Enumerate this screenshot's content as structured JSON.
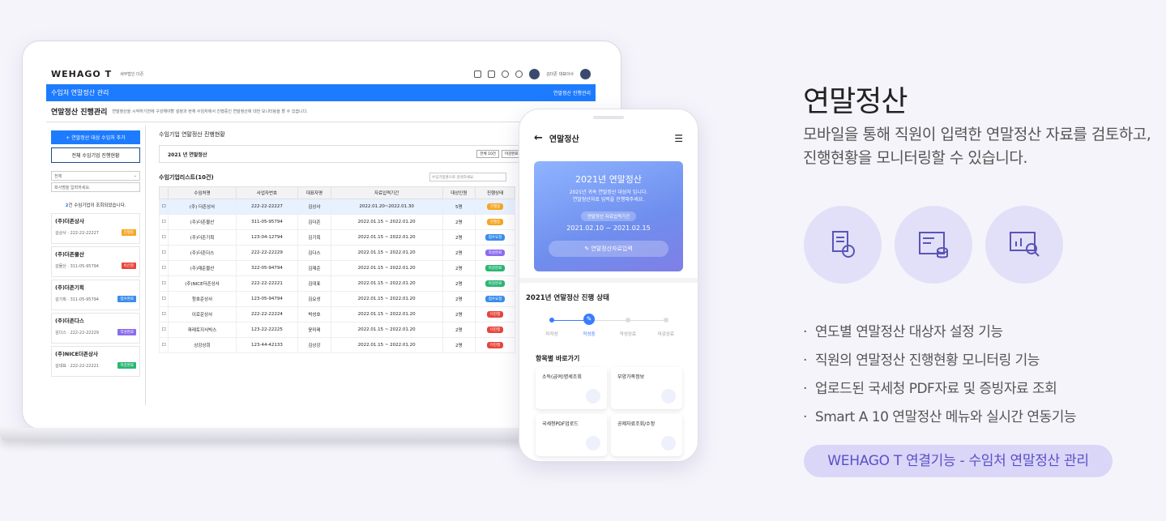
{
  "app": {
    "logo_prefix": "WEHAGO",
    "logo_suffix": "T",
    "company": "세무법인 더존"
  },
  "topbar": {
    "user": "김더존 대표이사"
  },
  "module": {
    "title": "수임처 연말정산 관리",
    "right": "연말정산 진행관리"
  },
  "page": {
    "title": "연말정산 진행관리",
    "desc": "연말정산을 시작하기전에 구성해야할 설정과 현재 수임처에서 진행중인 연말정산에 대한 모니터링을 할 수 있습니다."
  },
  "left": {
    "add_button": "연말정산 대상 수임처 추가",
    "status_button": "전체 수임기업 진행현황",
    "filter_value": "전체",
    "search_placeholder": "회사명을 입력하세요.",
    "count": "2",
    "count_text": "건 수임기업이 조회되었습니다.",
    "cards": [
      {
        "name": "(주)더존상사",
        "owner": "김상사 · 222-22-22227",
        "tag": "진행중",
        "color": "#f5a623"
      },
      {
        "name": "(주)더존물산",
        "owner": "김물산 · 311-05-95794",
        "tag": "비신청",
        "color": "#e8453c"
      },
      {
        "name": "(주)더존기획",
        "owner": "김기획 · 311-05-95794",
        "tag": "접수완료",
        "color": "#3b8dea"
      },
      {
        "name": "(주)더존다스",
        "owner": "김다스 · 222-22-22229",
        "tag": "작성완료",
        "color": "#8b6cf0"
      },
      {
        "name": "(주)NICE더존상사",
        "owner": "김대표 · 222-22-22221",
        "tag": "마감완료",
        "color": "#2bb673"
      }
    ]
  },
  "right": {
    "title": "수임기업 연말정산 진행현황",
    "year": "2021 년 연말정산",
    "pills": [
      {
        "label": "전체",
        "val": "10건"
      },
      {
        "label": "마감완료",
        "val": "2건"
      },
      {
        "label": "접수요청",
        "val": "2건"
      },
      {
        "label": "작성완료",
        "val": "1건"
      }
    ],
    "list_title": "수임기업리스트(10건)",
    "search_placeholder": "수임기업명으로 검색하세요.",
    "columns": [
      "",
      "수임처명",
      "사업자번호",
      "대표자명",
      "자료입력기간",
      "대상인원",
      "진행상태"
    ],
    "rows": [
      {
        "name": "(주) 더존상사",
        "biz": "222-22-22227",
        "ceo": "김상사",
        "period": "2022.01.20~2022.01.30",
        "n": "5명",
        "status": "진행중",
        "color": "#f5a623"
      },
      {
        "name": "(주)더존물산",
        "biz": "311-05-95794",
        "ceo": "김더존",
        "period": "2022.01.15 ~ 2022.01.20",
        "n": "2명",
        "status": "진행중",
        "color": "#f5a623"
      },
      {
        "name": "(주)더존기획",
        "biz": "123-04-12794",
        "ceo": "김기획",
        "period": "2022.01.15 ~ 2022.01.20",
        "n": "2명",
        "status": "접수요청",
        "color": "#3b8dea"
      },
      {
        "name": "(주)더존다스",
        "biz": "222-22-22229",
        "ceo": "김다스",
        "period": "2022.01.15 ~ 2022.01.20",
        "n": "2명",
        "status": "작성완료",
        "color": "#8b6cf0"
      },
      {
        "name": "(주)재준물산",
        "biz": "322-05-94794",
        "ceo": "김재준",
        "period": "2022.01.15 ~ 2022.01.20",
        "n": "2명",
        "status": "마감완료",
        "color": "#2bb673"
      },
      {
        "name": "(주)NICE더존상사",
        "biz": "222-22-22221",
        "ceo": "김대표",
        "period": "2022.01.15 ~ 2022.01.20",
        "n": "2명",
        "status": "마감완료",
        "color": "#2bb673"
      },
      {
        "name": "청호준상사",
        "biz": "123-05-94794",
        "ceo": "김요성",
        "period": "2022.01.15 ~ 2022.01.20",
        "n": "2명",
        "status": "접수요청",
        "color": "#3b8dea"
      },
      {
        "name": "이로운상사",
        "biz": "222-22-22224",
        "ceo": "박성호",
        "period": "2022.01.15 ~ 2022.01.20",
        "n": "2명",
        "status": "미진행",
        "color": "#e8453c"
      },
      {
        "name": "파레토지식빅스",
        "biz": "123-22-22225",
        "ceo": "윤미래",
        "period": "2022.01.15 ~ 2022.01.20",
        "n": "2명",
        "status": "미진행",
        "color": "#e8453c"
      },
      {
        "name": "상강상회",
        "biz": "123-44-42133",
        "ceo": "김상강",
        "period": "2022.01.15 ~ 2022.01.20",
        "n": "2명",
        "status": "미진행",
        "color": "#e8453c"
      }
    ]
  },
  "phone": {
    "header": "연말정산",
    "hero_title": "2021년 연말정산",
    "hero_line1": "2021년 귀속 연말정산 대상자 입니다.",
    "hero_line2": "연말정산자료 입력을 진행해주세요.",
    "period_label": "연말정산 자료입력기간",
    "period": "2021.02.10 ~ 2021.02.15",
    "input_button": "연말정산자료입력",
    "status_title": "2021년 연말정산 진행 상태",
    "steps": [
      "미작성",
      "작성중",
      "작성완료",
      "마감완료"
    ],
    "shortcut_title": "항목별 바로가기",
    "shortcuts": [
      "소득(급여)명세조회",
      "부양가족정보",
      "국세청PDF업로드",
      "공제자료조회/수정"
    ]
  },
  "marketing": {
    "title": "연말정산",
    "desc1": "모바일을 통해 직원이 입력한 연말정산 자료를 검토하고,",
    "desc2": "진행현황을 모니터링할 수 있습니다.",
    "features": [
      "연도별 연말정산 대상자 설정 기능",
      "직원의 연말정산 진행현황 모니터링 기능",
      "업로드된 국세청 PDF자료 및 증빙자료 조회",
      "Smart A 10 연말정산 메뉴와 실시간 연동기능"
    ],
    "link": "WEHAGO T 연결기능 - 수임처 연말정산 관리"
  }
}
